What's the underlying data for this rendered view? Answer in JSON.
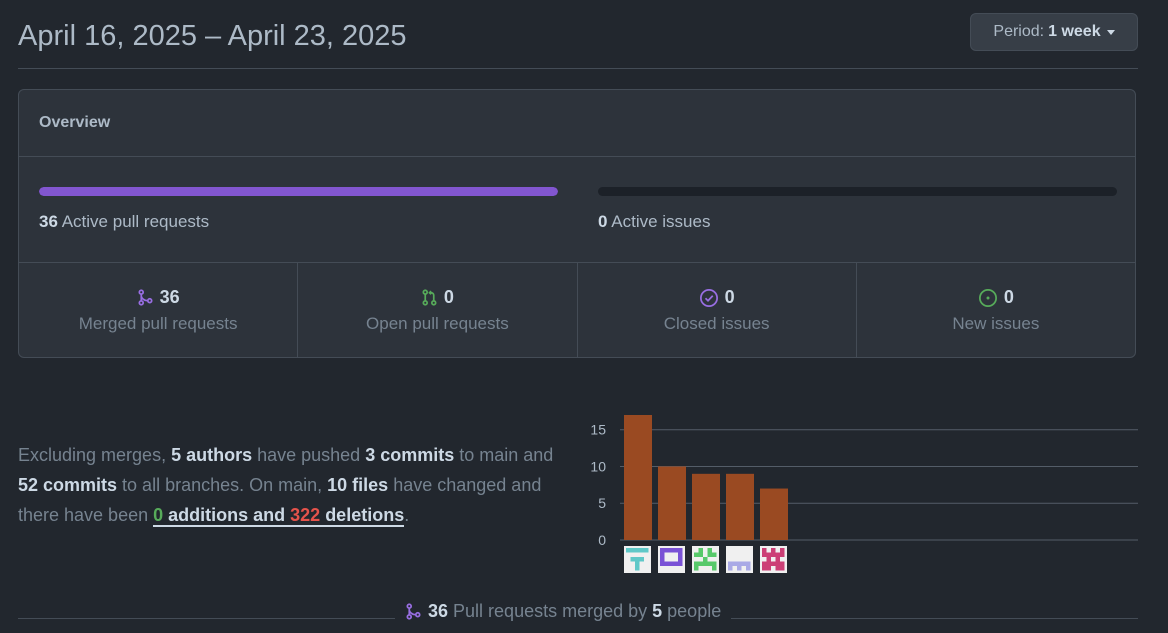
{
  "header": {
    "title": "April 16, 2025 – April 23, 2025",
    "period_label": "Period:",
    "period_value": "1 week"
  },
  "overview": {
    "title": "Overview",
    "active_prs": {
      "count": "36",
      "label": "Active pull requests",
      "fill_fraction": 1.0,
      "color": "#8256d0"
    },
    "active_issues": {
      "count": "0",
      "label": "Active issues",
      "fill_fraction": 0.0
    },
    "stats": [
      {
        "value": "36",
        "label": "Merged pull requests",
        "icon": "git-merge-icon",
        "color": "#986ee2"
      },
      {
        "value": "0",
        "label": "Open pull requests",
        "icon": "git-pull-request-icon",
        "color": "#57ab5a"
      },
      {
        "value": "0",
        "label": "Closed issues",
        "icon": "issue-closed-icon",
        "color": "#986ee2"
      },
      {
        "value": "0",
        "label": "New issues",
        "icon": "issue-opened-icon",
        "color": "#57ab5a"
      }
    ]
  },
  "summary": {
    "t1": "Excluding merges, ",
    "authors": "5 authors",
    "t2": " have pushed ",
    "commits_main": "3 commits",
    "t3": " to main and ",
    "commits_all": "52 commits",
    "t4": " to all branches. On main, ",
    "files": "10 files",
    "t5": " have changed and there have been ",
    "additions_num": "0",
    "additions_word": " additions",
    "and": " and ",
    "deletions_num": "322",
    "deletions_word": " deletions",
    "t6": "."
  },
  "chart_data": {
    "type": "bar",
    "categories": [
      "author-1",
      "author-2",
      "author-3",
      "author-4",
      "author-5"
    ],
    "values": [
      17,
      10,
      9,
      9,
      7
    ],
    "ylim": [
      0,
      17
    ],
    "yticks": [
      "0",
      "5",
      "10",
      "15"
    ],
    "bar_color": "#9a4a22",
    "avatar_colors": [
      "#5fc8c8",
      "#7a52d6",
      "#57c96a",
      "#a9a9e6",
      "#cc3f76"
    ]
  },
  "footer": {
    "count": "36",
    "t1": "Pull requests merged by",
    "people": "5",
    "t2": "people"
  }
}
